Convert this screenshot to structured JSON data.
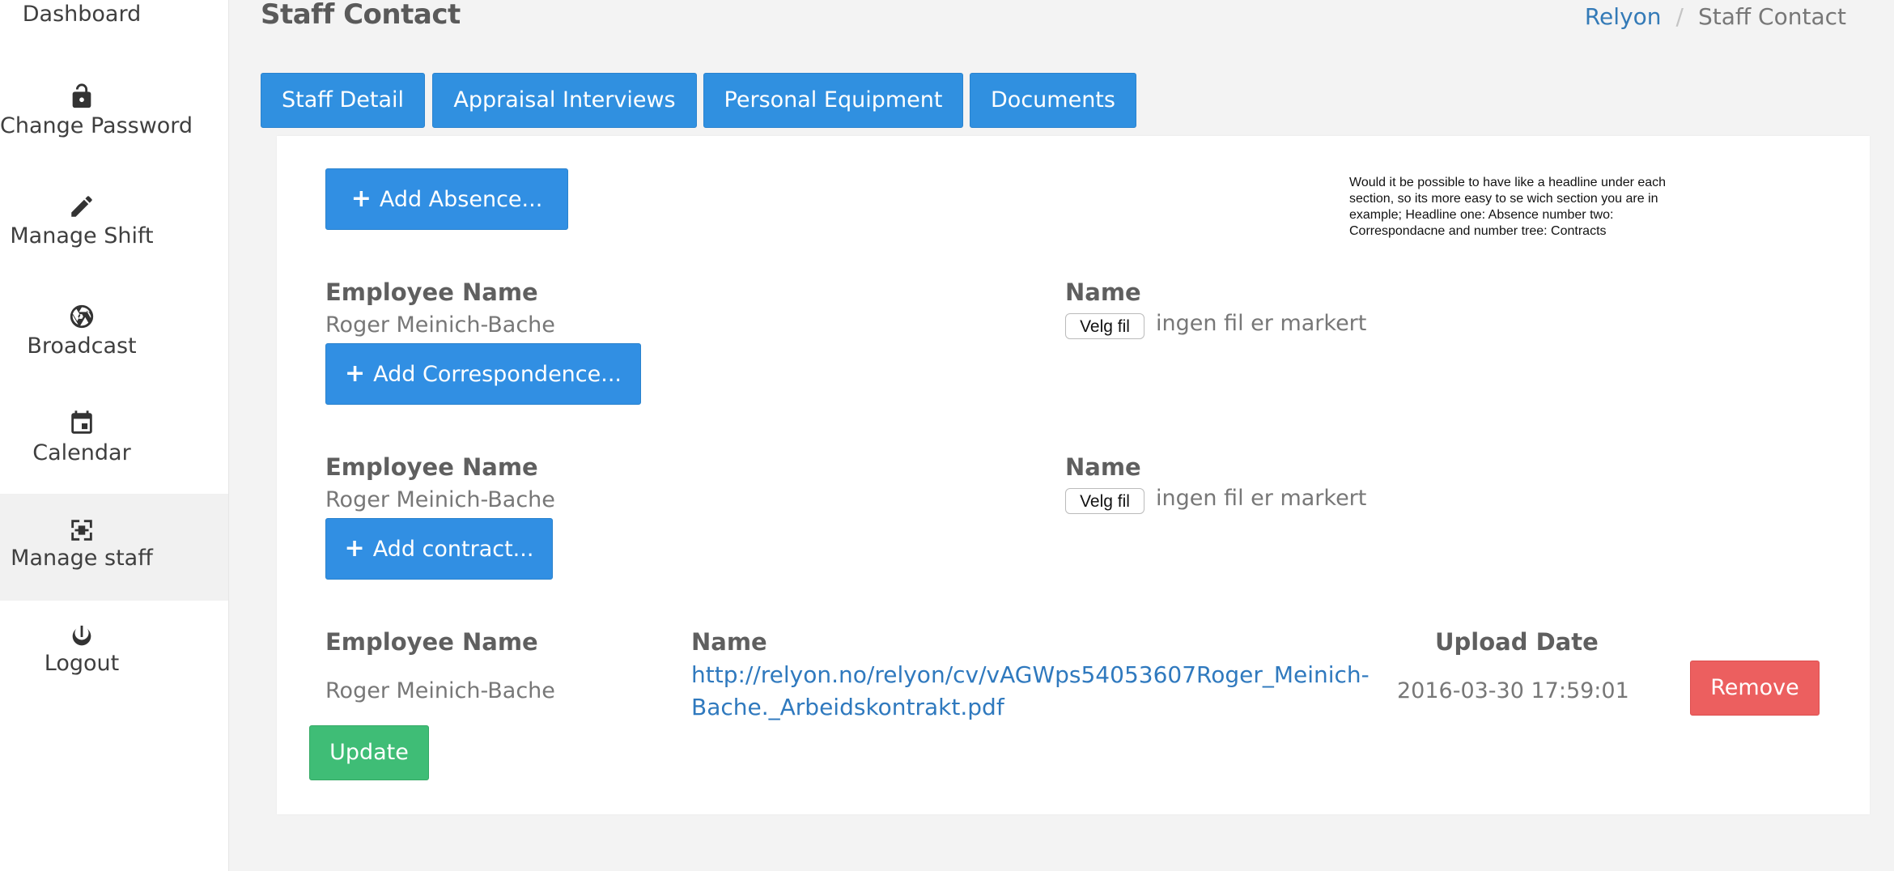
{
  "sidebar": {
    "items": [
      {
        "label": "Dashboard",
        "icon": "dashboard-icon"
      },
      {
        "label": "Change Password",
        "icon": "unlock-icon"
      },
      {
        "label": "Manage Shift",
        "icon": "pencil-icon"
      },
      {
        "label": "Broadcast",
        "icon": "aperture-icon"
      },
      {
        "label": "Calendar",
        "icon": "calendar-icon"
      },
      {
        "label": "Manage staff",
        "icon": "staff-icon",
        "active": true
      },
      {
        "label": "Logout",
        "icon": "power-icon"
      }
    ]
  },
  "header": {
    "title": "Staff Contact",
    "breadcrumb": {
      "home": "Relyon",
      "separator": "/",
      "current": "Staff Contact"
    }
  },
  "tabs": [
    {
      "label": "Staff Detail"
    },
    {
      "label": "Appraisal Interviews"
    },
    {
      "label": "Personal Equipment"
    },
    {
      "label": "Documents"
    }
  ],
  "note": "Would it be possible to have like a headline under each section, so its more easy to se wich section you are in example; Headline one: Absence number two: Correspondacne and number tree: Contracts",
  "absence": {
    "button_label": "Add Absence...",
    "employee_label": "Employee Name",
    "employee_value": "Roger Meinich-Bache",
    "name_label": "Name",
    "file_button": "Velg fil",
    "file_status": "ingen fil er markert"
  },
  "correspondence": {
    "button_label": "Add Correspondence...",
    "employee_label": "Employee Name",
    "employee_value": "Roger Meinich-Bache",
    "name_label": "Name",
    "file_button": "Velg fil",
    "file_status": "ingen fil er markert"
  },
  "contract": {
    "button_label": "Add contract...",
    "employee_label": "Employee Name",
    "name_label": "Name",
    "upload_label": "Upload Date",
    "row": {
      "employee": "Roger Meinich-Bache",
      "link_line1": "http://relyon.no/relyon/cv/vAGWps54053607Roger_Meinich-",
      "link_line2": "Bache._Arbeidskontrakt.pdf",
      "upload_date": "2016-03-30 17:59:01",
      "remove_label": "Remove"
    }
  },
  "update_label": "Update",
  "colors": {
    "primary": "#318fe3",
    "danger": "#ec5f5f",
    "success": "#3fbd76",
    "link": "#2f79be"
  }
}
